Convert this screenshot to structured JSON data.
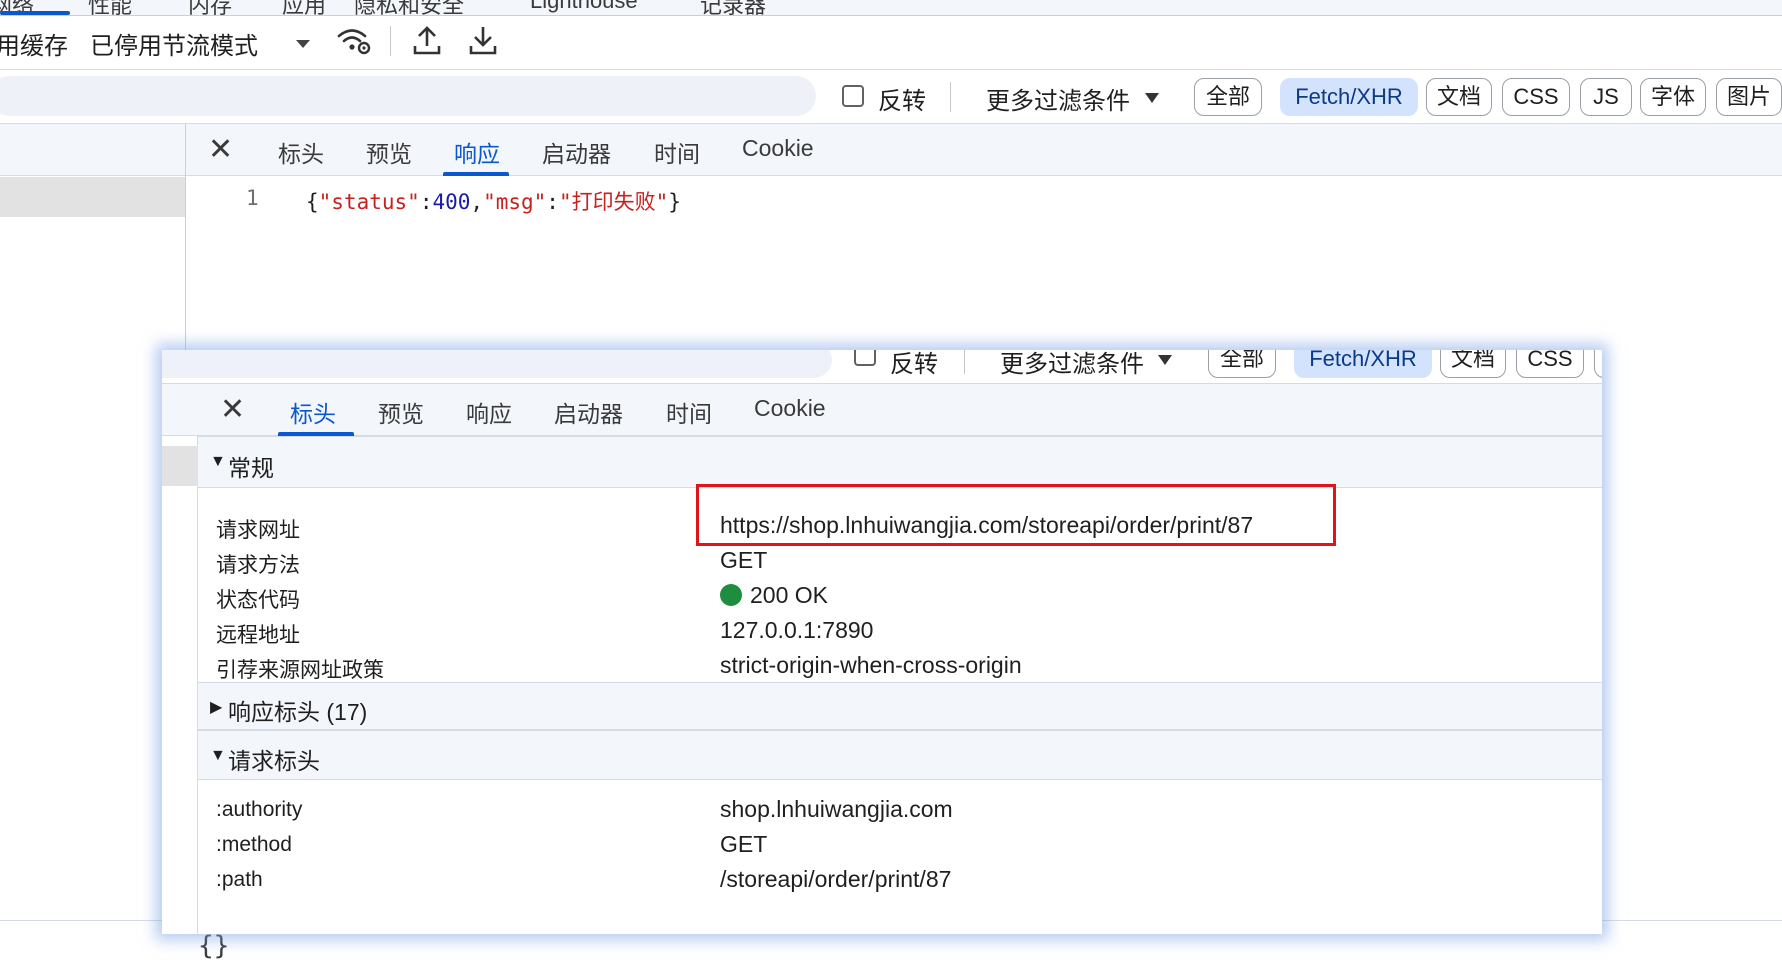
{
  "top_tabs": {
    "items": [
      "网络",
      "性能",
      "内存",
      "应用",
      "隐私和安全",
      "Lighthouse",
      "记录器"
    ]
  },
  "toolbar": {
    "disable_cache": "用缓存",
    "throttle": "已停用节流模式"
  },
  "filter": {
    "invert_label": "反转",
    "more_filters": "更多过滤条件",
    "types": [
      "全部",
      "Fetch/XHR",
      "文档",
      "CSS",
      "JS",
      "字体",
      "图片"
    ],
    "selected": "Fetch/XHR"
  },
  "response_tabs": {
    "items": [
      "标头",
      "预览",
      "响应",
      "启动器",
      "时间",
      "Cookie"
    ],
    "active": "响应"
  },
  "response_body": {
    "line_number": "1",
    "tokens": [
      "{",
      "\"status\"",
      ":",
      "400",
      ",",
      "\"msg\"",
      ":",
      "\"打印失败\"",
      "}"
    ]
  },
  "overlay": {
    "filter": {
      "invert_label": "反转",
      "more_filters": "更多过滤条件",
      "types": [
        "全部",
        "Fetch/XHR",
        "文档",
        "CSS"
      ]
    },
    "tabs": {
      "items": [
        "标头",
        "预览",
        "响应",
        "启动器",
        "时间",
        "Cookie"
      ],
      "active": "标头"
    },
    "general": {
      "title": "常规",
      "rows": [
        {
          "key": "请求网址",
          "value": "https://shop.lnhuiwangjia.com/storeapi/order/print/87"
        },
        {
          "key": "请求方法",
          "value": "GET"
        },
        {
          "key": "状态代码",
          "value": "200 OK"
        },
        {
          "key": "远程地址",
          "value": "127.0.0.1:7890"
        },
        {
          "key": "引荐来源网址政策",
          "value": "strict-origin-when-cross-origin"
        }
      ]
    },
    "response_headers": {
      "title": "响应标头 (17)"
    },
    "request_headers": {
      "title": "请求标头",
      "rows": [
        {
          "key": ":authority",
          "value": "shop.lnhuiwangjia.com"
        },
        {
          "key": ":method",
          "value": "GET"
        },
        {
          "key": ":path",
          "value": "/storeapi/order/print/87"
        }
      ]
    },
    "colors": {
      "status_ok": "#1e8e3e",
      "highlight_box": "#e0151b",
      "accent": "#0b57d0"
    }
  },
  "bottom": {
    "pretty_print_icon": "curly-braces-icon"
  }
}
